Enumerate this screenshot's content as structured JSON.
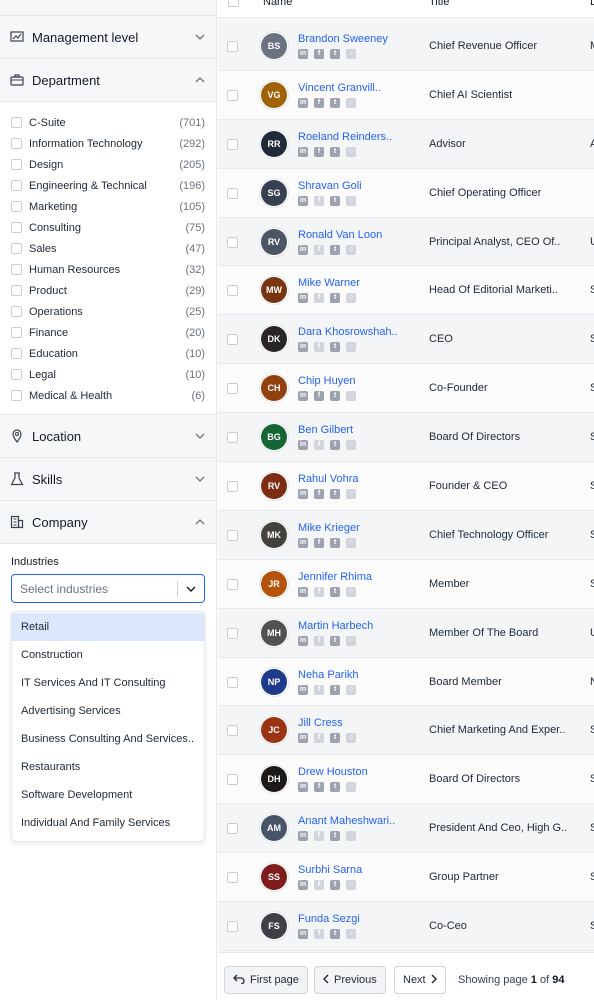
{
  "sidebar": {
    "sections": {
      "management_level": "Management level",
      "department": "Department",
      "location": "Location",
      "skills": "Skills",
      "company": "Company"
    },
    "departments": [
      {
        "label": "C-Suite",
        "count": "(701)"
      },
      {
        "label": "Information Technology",
        "count": "(292)"
      },
      {
        "label": "Design",
        "count": "(205)"
      },
      {
        "label": "Engineering & Technical",
        "count": "(196)"
      },
      {
        "label": "Marketing",
        "count": "(105)"
      },
      {
        "label": "Consulting",
        "count": "(75)"
      },
      {
        "label": "Sales",
        "count": "(47)"
      },
      {
        "label": "Human Resources",
        "count": "(32)"
      },
      {
        "label": "Product",
        "count": "(29)"
      },
      {
        "label": "Operations",
        "count": "(25)"
      },
      {
        "label": "Finance",
        "count": "(20)"
      },
      {
        "label": "Education",
        "count": "(10)"
      },
      {
        "label": "Legal",
        "count": "(10)"
      },
      {
        "label": "Medical & Health",
        "count": "(6)"
      }
    ],
    "industries": {
      "label": "Industries",
      "placeholder": "Select industries",
      "options": [
        "Retail",
        "Construction",
        "IT Services And IT Consulting",
        "Advertising Services",
        "Business Consulting And Services..",
        "Restaurants",
        "Software Development",
        "Individual And Family Services"
      ],
      "highlighted": "Retail"
    }
  },
  "table": {
    "headers": {
      "name": "Name",
      "title": "Title",
      "col3": "L"
    },
    "rows": [
      {
        "name": "Brandon Sweeney",
        "title": "Chief Revenue Officer",
        "col3": "M",
        "initials": "BS",
        "color": "#6b7280",
        "fb": true
      },
      {
        "name": "Vincent Granvill..",
        "title": "Chief AI Scientist",
        "col3": "",
        "initials": "VG",
        "color": "#a16207",
        "fb": true
      },
      {
        "name": "Roeland Reinders..",
        "title": "Advisor",
        "col3": "A",
        "initials": "RR",
        "color": "#1f2937",
        "fb": true
      },
      {
        "name": "Shravan Goli",
        "title": "Chief Operating Officer",
        "col3": "",
        "initials": "SG",
        "color": "#374151",
        "fb": false
      },
      {
        "name": "Ronald Van Loon",
        "title": "Principal Analyst, CEO Of..",
        "col3": "U",
        "initials": "RV",
        "color": "#4b5563",
        "fb": false
      },
      {
        "name": "Mike Warner",
        "title": "Head Of Editorial Marketi..",
        "col3": "S",
        "initials": "MW",
        "color": "#78350f",
        "fb": false
      },
      {
        "name": "Dara Khosrowshah..",
        "title": "CEO",
        "col3": "S",
        "initials": "DK",
        "color": "#292524",
        "fb": false
      },
      {
        "name": "Chip Huyen",
        "title": "Co-Founder",
        "col3": "S",
        "initials": "CH",
        "color": "#92400e",
        "fb": true
      },
      {
        "name": "Ben Gilbert",
        "title": "Board Of Directors",
        "col3": "S",
        "initials": "BG",
        "color": "#166534",
        "fb": false
      },
      {
        "name": "Rahul Vohra",
        "title": "Founder & CEO",
        "col3": "S",
        "initials": "RV",
        "color": "#7c2d12",
        "fb": true
      },
      {
        "name": "Mike Krieger",
        "title": "Chief Technology Officer",
        "col3": "S",
        "initials": "MK",
        "color": "#44403c",
        "fb": true
      },
      {
        "name": "Jennifer Rhima",
        "title": "Member",
        "col3": "S",
        "initials": "JR",
        "color": "#b45309",
        "fb": false
      },
      {
        "name": "Martin Harbech",
        "title": "Member Of The Board",
        "col3": "U",
        "initials": "MH",
        "color": "#525252",
        "fb": false
      },
      {
        "name": "Neha Parikh",
        "title": "Board Member",
        "col3": "N",
        "initials": "NP",
        "color": "#1e3a8a",
        "fb": false
      },
      {
        "name": "Jill Cress",
        "title": "Chief Marketing And Exper..",
        "col3": "S",
        "initials": "JC",
        "color": "#9a3412",
        "fb": false
      },
      {
        "name": "Drew Houston",
        "title": "Board Of Directors",
        "col3": "S",
        "initials": "DH",
        "color": "#1c1917",
        "fb": true
      },
      {
        "name": "Anant Maheshwari..",
        "title": "President And Ceo, High G..",
        "col3": "S",
        "initials": "AM",
        "color": "#475569",
        "fb": false
      },
      {
        "name": "Surbhi Sarna",
        "title": "Group Partner",
        "col3": "S",
        "initials": "SS",
        "color": "#7f1d1d",
        "fb": false
      },
      {
        "name": "Funda Sezgi",
        "title": "Co-Ceo",
        "col3": "S",
        "initials": "FS",
        "color": "#3f3f46",
        "fb": false
      }
    ]
  },
  "pager": {
    "first": "First page",
    "previous": "Previous",
    "next": "Next",
    "showing_prefix": "Showing page",
    "current": "1",
    "of": "of",
    "total": "94"
  }
}
